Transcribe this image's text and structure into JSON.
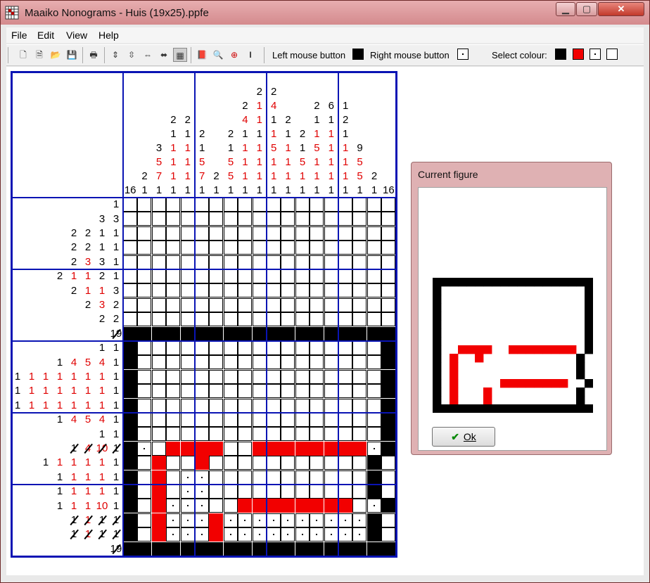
{
  "window": {
    "title": "Maaiko Nonograms - Huis (19x25).ppfe",
    "minimize": "▁",
    "maximize": "▢",
    "close": "✕",
    "app_icon": "grid-icon"
  },
  "menu": [
    "File",
    "Edit",
    "View",
    "Help"
  ],
  "toolbar": {
    "buttons": [
      "new-icon",
      "open-icon",
      "open-folder-icon",
      "save-icon",
      "print-icon",
      "insert-row-icon",
      "delete-row-icon",
      "insert-col-icon",
      "delete-col-icon",
      "grid-mode-icon",
      "book-icon",
      "preview-icon",
      "zoom-icon",
      "text-cursor-icon"
    ],
    "left_label": "Left mouse button",
    "right_label": "Right mouse button",
    "select_label": "Select colour:",
    "colors": {
      "black": "#000000",
      "red": "#f20000",
      "white": "#ffffff"
    }
  },
  "puzzle": {
    "columns": 19,
    "rows": 25,
    "column_clues": [
      [
        {
          "v": "16",
          "c": "k"
        }
      ],
      [
        {
          "v": "2",
          "c": "k"
        },
        {
          "v": "1",
          "c": "k"
        }
      ],
      [
        {
          "v": "3",
          "c": "k"
        },
        {
          "v": "5",
          "c": "r"
        },
        {
          "v": "7",
          "c": "r"
        },
        {
          "v": "1",
          "c": "k"
        }
      ],
      [
        {
          "v": "2",
          "c": "k"
        },
        {
          "v": "1",
          "c": "k"
        },
        {
          "v": "1",
          "c": "r"
        },
        {
          "v": "1",
          "c": "r"
        },
        {
          "v": "1",
          "c": "r"
        },
        {
          "v": "1",
          "c": "k"
        }
      ],
      [
        {
          "v": "2",
          "c": "k"
        },
        {
          "v": "1",
          "c": "k"
        },
        {
          "v": "1",
          "c": "r"
        },
        {
          "v": "1",
          "c": "r"
        },
        {
          "v": "1",
          "c": "r"
        },
        {
          "v": "1",
          "c": "k"
        }
      ],
      [
        {
          "v": "2",
          "c": "k"
        },
        {
          "v": "1",
          "c": "k"
        },
        {
          "v": "5",
          "c": "r"
        },
        {
          "v": "7",
          "c": "r"
        },
        {
          "v": "1",
          "c": "k"
        }
      ],
      [
        {
          "v": "2",
          "c": "k"
        },
        {
          "v": "1",
          "c": "k"
        }
      ],
      [
        {
          "v": "2",
          "c": "k"
        },
        {
          "v": "1",
          "c": "k"
        },
        {
          "v": "5",
          "c": "r"
        },
        {
          "v": "5",
          "c": "r"
        },
        {
          "v": "1",
          "c": "k"
        }
      ],
      [
        {
          "v": "2",
          "c": "k"
        },
        {
          "v": "4",
          "c": "r"
        },
        {
          "v": "1",
          "c": "k"
        },
        {
          "v": "1",
          "c": "r"
        },
        {
          "v": "1",
          "c": "r"
        },
        {
          "v": "1",
          "c": "r"
        },
        {
          "v": "1",
          "c": "k"
        }
      ],
      [
        {
          "v": "2",
          "c": "k"
        },
        {
          "v": "1",
          "c": "r"
        },
        {
          "v": "1",
          "c": "r"
        },
        {
          "v": "1",
          "c": "k"
        },
        {
          "v": "1",
          "c": "r"
        },
        {
          "v": "1",
          "c": "r"
        },
        {
          "v": "1",
          "c": "r"
        },
        {
          "v": "1",
          "c": "k"
        }
      ],
      [
        {
          "v": "2",
          "c": "k"
        },
        {
          "v": "4",
          "c": "r"
        },
        {
          "v": "1",
          "c": "k"
        },
        {
          "v": "1",
          "c": "r"
        },
        {
          "v": "5",
          "c": "r"
        },
        {
          "v": "1",
          "c": "r"
        },
        {
          "v": "1",
          "c": "r"
        },
        {
          "v": "1",
          "c": "k"
        }
      ],
      [
        {
          "v": "2",
          "c": "k"
        },
        {
          "v": "1",
          "c": "k"
        },
        {
          "v": "1",
          "c": "r"
        },
        {
          "v": "1",
          "c": "r"
        },
        {
          "v": "1",
          "c": "r"
        },
        {
          "v": "1",
          "c": "k"
        }
      ],
      [
        {
          "v": "2",
          "c": "k"
        },
        {
          "v": "1",
          "c": "k"
        },
        {
          "v": "5",
          "c": "r"
        },
        {
          "v": "1",
          "c": "r"
        },
        {
          "v": "1",
          "c": "k"
        }
      ],
      [
        {
          "v": "2",
          "c": "k"
        },
        {
          "v": "1",
          "c": "k"
        },
        {
          "v": "1",
          "c": "r"
        },
        {
          "v": "5",
          "c": "r"
        },
        {
          "v": "1",
          "c": "r"
        },
        {
          "v": "1",
          "c": "r"
        },
        {
          "v": "1",
          "c": "k"
        }
      ],
      [
        {
          "v": "6",
          "c": "k"
        },
        {
          "v": "1",
          "c": "k"
        },
        {
          "v": "1",
          "c": "r"
        },
        {
          "v": "1",
          "c": "r"
        },
        {
          "v": "1",
          "c": "r"
        },
        {
          "v": "1",
          "c": "r"
        },
        {
          "v": "1",
          "c": "k"
        }
      ],
      [
        {
          "v": "1",
          "c": "k"
        },
        {
          "v": "2",
          "c": "k"
        },
        {
          "v": "1",
          "c": "k"
        },
        {
          "v": "1",
          "c": "r"
        },
        {
          "v": "1",
          "c": "r"
        },
        {
          "v": "1",
          "c": "r"
        },
        {
          "v": "1",
          "c": "k"
        }
      ],
      [
        {
          "v": "9",
          "c": "k"
        },
        {
          "v": "5",
          "c": "r"
        },
        {
          "v": "5",
          "c": "r"
        },
        {
          "v": "1",
          "c": "k"
        }
      ],
      [
        {
          "v": "2",
          "c": "k"
        },
        {
          "v": "1",
          "c": "k"
        }
      ],
      [
        {
          "v": "16",
          "c": "k"
        }
      ]
    ],
    "row_clues": [
      [
        {
          "v": "1",
          "c": "k"
        }
      ],
      [
        {
          "v": "3",
          "c": "k"
        },
        {
          "v": "3",
          "c": "k"
        }
      ],
      [
        {
          "v": "2",
          "c": "k"
        },
        {
          "v": "2",
          "c": "k"
        },
        {
          "v": "1",
          "c": "k"
        },
        {
          "v": "1",
          "c": "k"
        }
      ],
      [
        {
          "v": "2",
          "c": "k"
        },
        {
          "v": "2",
          "c": "k"
        },
        {
          "v": "1",
          "c": "k"
        },
        {
          "v": "1",
          "c": "k"
        }
      ],
      [
        {
          "v": "2",
          "c": "k"
        },
        {
          "v": "3",
          "c": "r"
        },
        {
          "v": "3",
          "c": "k"
        },
        {
          "v": "1",
          "c": "k"
        }
      ],
      [
        {
          "v": "2",
          "c": "k"
        },
        {
          "v": "1",
          "c": "r"
        },
        {
          "v": "1",
          "c": "r"
        },
        {
          "v": "2",
          "c": "k"
        },
        {
          "v": "1",
          "c": "k"
        }
      ],
      [
        {
          "v": "2",
          "c": "k"
        },
        {
          "v": "1",
          "c": "r"
        },
        {
          "v": "1",
          "c": "r"
        },
        {
          "v": "3",
          "c": "k"
        }
      ],
      [
        {
          "v": "2",
          "c": "k"
        },
        {
          "v": "3",
          "c": "r"
        },
        {
          "v": "2",
          "c": "k"
        }
      ],
      [
        {
          "v": "2",
          "c": "k"
        },
        {
          "v": "2",
          "c": "k"
        }
      ],
      [
        {
          "v": "19",
          "c": "k",
          "x": true
        }
      ],
      [
        {
          "v": "1",
          "c": "k"
        },
        {
          "v": "1",
          "c": "k"
        }
      ],
      [
        {
          "v": "1",
          "c": "k"
        },
        {
          "v": "4",
          "c": "r"
        },
        {
          "v": "5",
          "c": "r"
        },
        {
          "v": "4",
          "c": "r"
        },
        {
          "v": "1",
          "c": "k"
        }
      ],
      [
        {
          "v": "1",
          "c": "k"
        },
        {
          "v": "1",
          "c": "r"
        },
        {
          "v": "1",
          "c": "r"
        },
        {
          "v": "1",
          "c": "r"
        },
        {
          "v": "1",
          "c": "r"
        },
        {
          "v": "1",
          "c": "r"
        },
        {
          "v": "1",
          "c": "r"
        },
        {
          "v": "1",
          "c": "k"
        }
      ],
      [
        {
          "v": "1",
          "c": "k"
        },
        {
          "v": "1",
          "c": "r"
        },
        {
          "v": "1",
          "c": "r"
        },
        {
          "v": "1",
          "c": "r"
        },
        {
          "v": "1",
          "c": "r"
        },
        {
          "v": "1",
          "c": "r"
        },
        {
          "v": "1",
          "c": "r"
        },
        {
          "v": "1",
          "c": "k"
        }
      ],
      [
        {
          "v": "1",
          "c": "k"
        },
        {
          "v": "1",
          "c": "r"
        },
        {
          "v": "1",
          "c": "r"
        },
        {
          "v": "1",
          "c": "r"
        },
        {
          "v": "1",
          "c": "r"
        },
        {
          "v": "1",
          "c": "r"
        },
        {
          "v": "1",
          "c": "r"
        },
        {
          "v": "1",
          "c": "k"
        }
      ],
      [
        {
          "v": "1",
          "c": "k"
        },
        {
          "v": "4",
          "c": "r"
        },
        {
          "v": "5",
          "c": "r"
        },
        {
          "v": "4",
          "c": "r"
        },
        {
          "v": "1",
          "c": "k"
        }
      ],
      [
        {
          "v": "1",
          "c": "k"
        },
        {
          "v": "1",
          "c": "k"
        }
      ],
      [
        {
          "v": "1",
          "c": "k",
          "x": true
        },
        {
          "v": "4",
          "c": "r",
          "x": true
        },
        {
          "v": "10",
          "c": "r",
          "x": true
        },
        {
          "v": "1",
          "c": "k",
          "x": true
        }
      ],
      [
        {
          "v": "1",
          "c": "k"
        },
        {
          "v": "1",
          "c": "r"
        },
        {
          "v": "1",
          "c": "r"
        },
        {
          "v": "1",
          "c": "r"
        },
        {
          "v": "1",
          "c": "r"
        },
        {
          "v": "1",
          "c": "k"
        }
      ],
      [
        {
          "v": "1",
          "c": "k"
        },
        {
          "v": "1",
          "c": "r"
        },
        {
          "v": "1",
          "c": "r"
        },
        {
          "v": "1",
          "c": "r"
        },
        {
          "v": "1",
          "c": "k"
        }
      ],
      [
        {
          "v": "1",
          "c": "k"
        },
        {
          "v": "1",
          "c": "r"
        },
        {
          "v": "1",
          "c": "r"
        },
        {
          "v": "1",
          "c": "r"
        },
        {
          "v": "1",
          "c": "k"
        }
      ],
      [
        {
          "v": "1",
          "c": "k"
        },
        {
          "v": "1",
          "c": "r"
        },
        {
          "v": "1",
          "c": "r"
        },
        {
          "v": "10",
          "c": "r"
        },
        {
          "v": "1",
          "c": "k"
        }
      ],
      [
        {
          "v": "1",
          "c": "k",
          "x": true
        },
        {
          "v": "1",
          "c": "r",
          "x": true
        },
        {
          "v": "1",
          "c": "k",
          "x": true
        },
        {
          "v": "1",
          "c": "k",
          "x": true
        }
      ],
      [
        {
          "v": "1",
          "c": "k",
          "x": true
        },
        {
          "v": "1",
          "c": "r",
          "x": true
        },
        {
          "v": "1",
          "c": "k",
          "x": true
        },
        {
          "v": "1",
          "c": "k",
          "x": true
        }
      ],
      [
        {
          "v": "19",
          "c": "k",
          "x": true
        }
      ]
    ],
    "grid": [
      "...................",
      "...................",
      "...................",
      "...................",
      "...................",
      "...................",
      "...................",
      "...................",
      "...................",
      "BBBBBBBBBBBBBBBBBBB",
      "B.................B",
      "B.................B",
      "B.................B",
      "B.................B",
      "B.................B",
      "B.................B",
      "B.................B",
      "Bd.RRRR..RRRRRRRRdB",
      "B.R..R...........B",
      "B.R.dd...........B",
      "B.R.dd...........B",
      "B.Rddd..RRRRRRRR.dB",
      "B.RdddRddddddddddB",
      "B.RdddRddddddddddB",
      "BBBBBBBBBBBBBBBBBBB"
    ]
  },
  "figure_window": {
    "title": "Current figure",
    "ok_label": "Ok",
    "ok_icon": "checkmark-icon"
  }
}
